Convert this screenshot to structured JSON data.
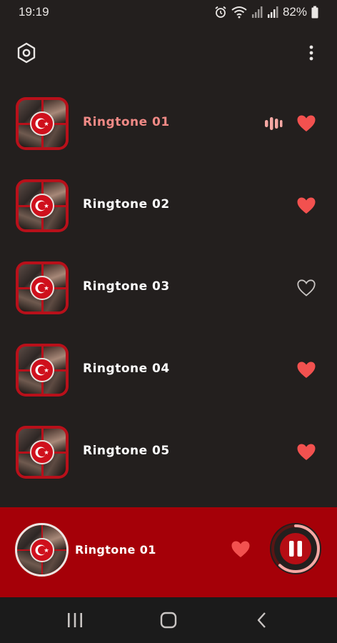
{
  "status_bar": {
    "time": "19:19",
    "battery_percent": "82%",
    "icons": [
      "alarm-icon",
      "wifi-icon",
      "signal-icon",
      "signal-icon",
      "battery-icon"
    ]
  },
  "app_bar": {
    "settings_icon": "settings-hexagon-icon",
    "more_icon": "more-vertical-icon"
  },
  "ringtones": [
    {
      "title": "Ringtone 01",
      "favorite": true,
      "playing": true
    },
    {
      "title": "Ringtone 02",
      "favorite": true,
      "playing": false
    },
    {
      "title": "Ringtone 03",
      "favorite": false,
      "playing": false
    },
    {
      "title": "Ringtone 04",
      "favorite": true,
      "playing": false
    },
    {
      "title": "Ringtone 05",
      "favorite": true,
      "playing": false
    }
  ],
  "player": {
    "title": "Ringtone 01",
    "favorite": true,
    "state": "playing",
    "progress": 0.62
  },
  "nav_bar": {
    "buttons": [
      "recents-icon",
      "home-icon",
      "back-icon"
    ]
  },
  "colors": {
    "background": "#231f1e",
    "accent_red": "#a50008",
    "heart_red": "#f2514f",
    "active_title": "#f18a86"
  }
}
